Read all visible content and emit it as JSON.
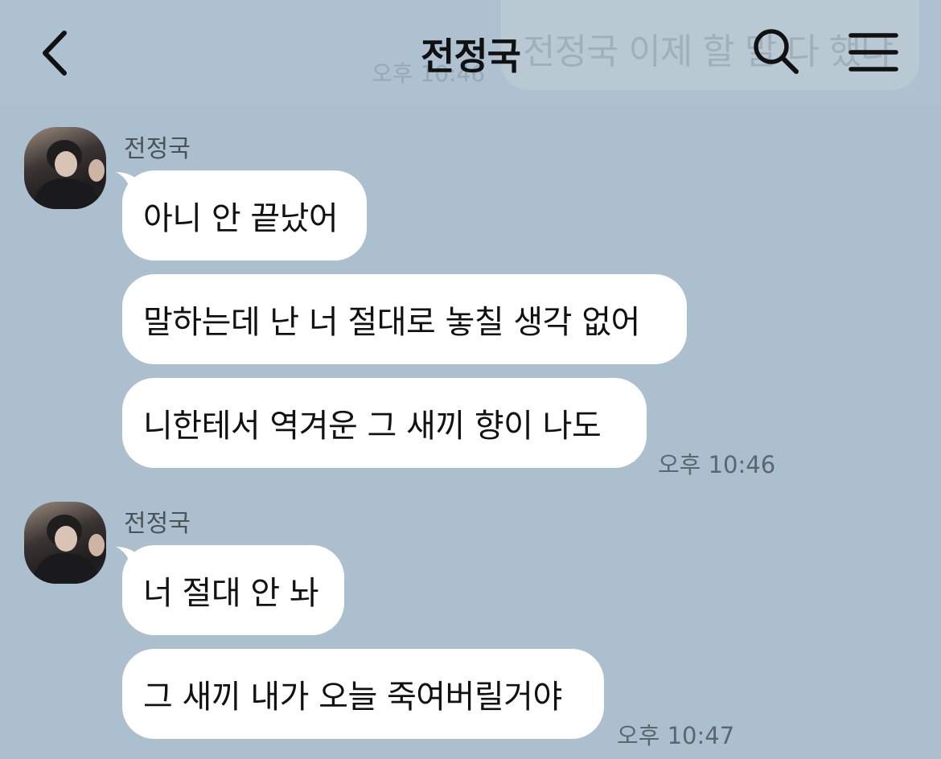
{
  "header": {
    "title": "전정국",
    "back_icon": "chevron-left-icon",
    "search_icon": "search-icon",
    "menu_icon": "hamburger-menu-icon"
  },
  "ghost_message": {
    "text": "전정국 이제 할 말 다 했냐",
    "time": "오후 10:46"
  },
  "groups": [
    {
      "sender": "전정국",
      "messages": [
        "아니 안 끝났어",
        "말하는데 난 너 절대로 놓칠 생각 없어",
        "니한테서 역겨운 그 새끼 향이 나도"
      ],
      "time": "오후 10:46"
    },
    {
      "sender": "전정국",
      "messages": [
        "너 절대 안 놔",
        "그 새끼 내가 오늘 죽여버릴거야"
      ],
      "time": "오후 10:47"
    }
  ],
  "colors": {
    "background": "#abbfcf",
    "bubble": "#ffffff",
    "text": "#111111",
    "time": "#5b666e"
  }
}
